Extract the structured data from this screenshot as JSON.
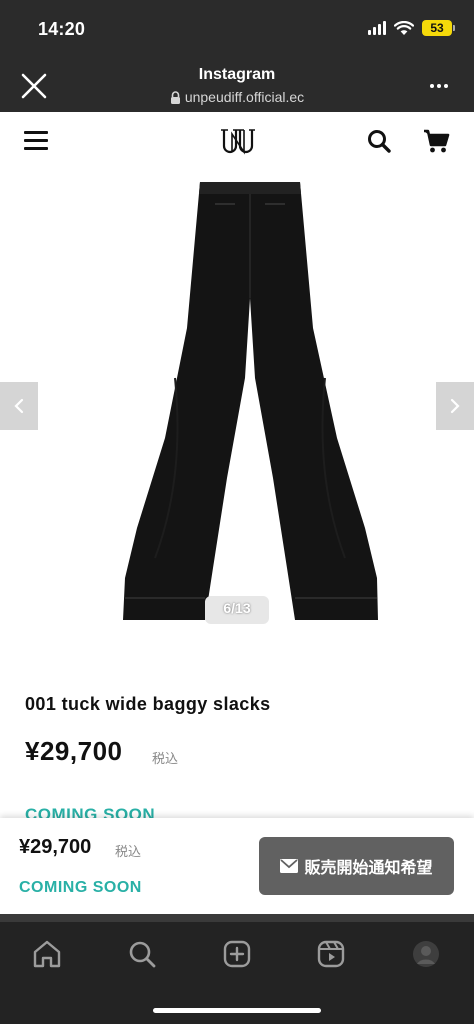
{
  "status_bar": {
    "time": "14:20",
    "battery": "53",
    "icons": [
      "signal-icon",
      "wifi-icon",
      "battery-icon"
    ]
  },
  "browser": {
    "title": "Instagram",
    "url": "unpeudiff.official.ec",
    "icons": [
      "close-icon",
      "lock-icon",
      "more-icon"
    ]
  },
  "site_header": {
    "icons": [
      "menu-icon",
      "logo",
      "search-icon",
      "cart-icon"
    ]
  },
  "gallery": {
    "counter": "6/13",
    "icons": [
      "chevron-left-icon",
      "chevron-right-icon"
    ]
  },
  "product": {
    "title": "001 tuck wide baggy slacks",
    "price": "¥29,700",
    "tax_label": "税込",
    "status": "COMING SOON"
  },
  "sticky": {
    "price": "¥29,700",
    "tax_label": "税込",
    "status": "COMING SOON",
    "notify_label": "販売開始通知希望",
    "notify_icon": "mail-icon"
  },
  "tab_bar": {
    "icons": [
      "home-icon",
      "search-icon",
      "add-icon",
      "reels-icon",
      "profile-icon"
    ]
  },
  "colors": {
    "accent": "#29b0a6",
    "button": "#616161",
    "chrome": "#2b2b2b"
  }
}
